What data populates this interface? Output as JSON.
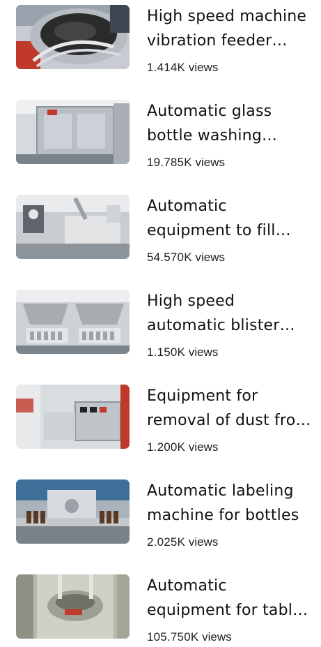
{
  "videos": [
    {
      "title": "High speed machine vibration feeder bowl",
      "views": "1.414K",
      "views_suffix": " views",
      "thumbnail_icon": "vibration-bowl-thumbnail"
    },
    {
      "title": "Automatic glass bottle washing machine",
      "views": "19.785K",
      "views_suffix": " views",
      "thumbnail_icon": "bottle-washing-thumbnail"
    },
    {
      "title": "Automatic equipment to fill capsules",
      "views": "54.570K",
      "views_suffix": " views",
      "thumbnail_icon": "capsule-filling-thumbnail"
    },
    {
      "title": "High speed automatic blister packing",
      "views": "1.150K",
      "views_suffix": " views",
      "thumbnail_icon": "blister-packing-thumbnail"
    },
    {
      "title": "Equipment for removal of dust from tablets",
      "views": "1.200K",
      "views_suffix": " views",
      "thumbnail_icon": "dust-removal-thumbnail"
    },
    {
      "title": "Automatic labeling machine for bottles",
      "views": "2.025K",
      "views_suffix": " views",
      "thumbnail_icon": "labeling-machine-thumbnail"
    },
    {
      "title": "Automatic equipment for tablet pressing",
      "views": "105.750K",
      "views_suffix": " views",
      "thumbnail_icon": "tablet-press-thumbnail"
    }
  ]
}
